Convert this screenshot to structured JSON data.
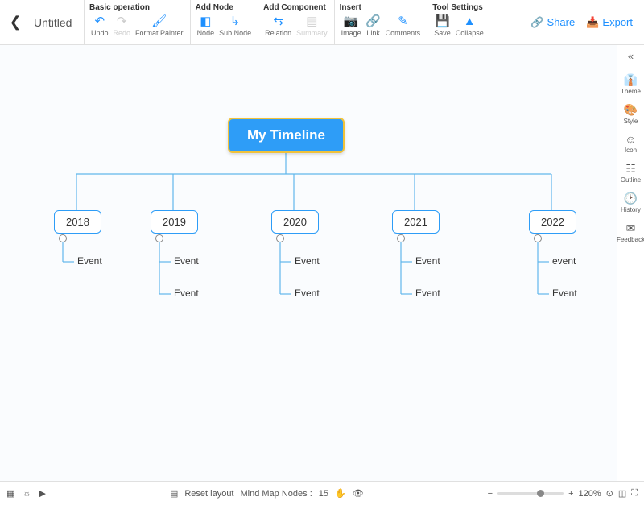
{
  "header": {
    "title": "Untitled",
    "share": "Share",
    "export": "Export"
  },
  "toolbar": {
    "basic": {
      "label": "Basic operation",
      "undo": "Undo",
      "redo": "Redo",
      "format_painter": "Format Painter"
    },
    "addnode": {
      "label": "Add Node",
      "node": "Node",
      "subnode": "Sub Node"
    },
    "addcomponent": {
      "label": "Add Component",
      "relation": "Relation",
      "summary": "Summary"
    },
    "insert": {
      "label": "Insert",
      "image": "Image",
      "link": "Link",
      "comments": "Comments"
    },
    "tool": {
      "label": "Tool Settings",
      "save": "Save",
      "collapse": "Collapse"
    }
  },
  "rightpanel": {
    "theme": "Theme",
    "style": "Style",
    "icon": "Icon",
    "outline": "Outline",
    "history": "History",
    "feedback": "Feedback"
  },
  "statusbar": {
    "reset": "Reset layout",
    "nodes_label": "Mind Map Nodes :",
    "nodes_count": "15",
    "zoom": "120%"
  },
  "mindmap": {
    "root": "My Timeline",
    "years": [
      {
        "year": "2018",
        "items": [
          "Event"
        ]
      },
      {
        "year": "2019",
        "items": [
          "Event",
          "Event"
        ]
      },
      {
        "year": "2020",
        "items": [
          "Event",
          "Event"
        ]
      },
      {
        "year": "2021",
        "items": [
          "Event",
          "Event"
        ]
      },
      {
        "year": "2022",
        "items": [
          "event",
          "Event"
        ]
      }
    ]
  },
  "chart_data": {
    "type": "tree",
    "title": "My Timeline",
    "root": "My Timeline",
    "children": [
      {
        "label": "2018",
        "children": [
          "Event"
        ]
      },
      {
        "label": "2019",
        "children": [
          "Event",
          "Event"
        ]
      },
      {
        "label": "2020",
        "children": [
          "Event",
          "Event"
        ]
      },
      {
        "label": "2021",
        "children": [
          "Event",
          "Event"
        ]
      },
      {
        "label": "2022",
        "children": [
          "event",
          "Event"
        ]
      }
    ]
  }
}
